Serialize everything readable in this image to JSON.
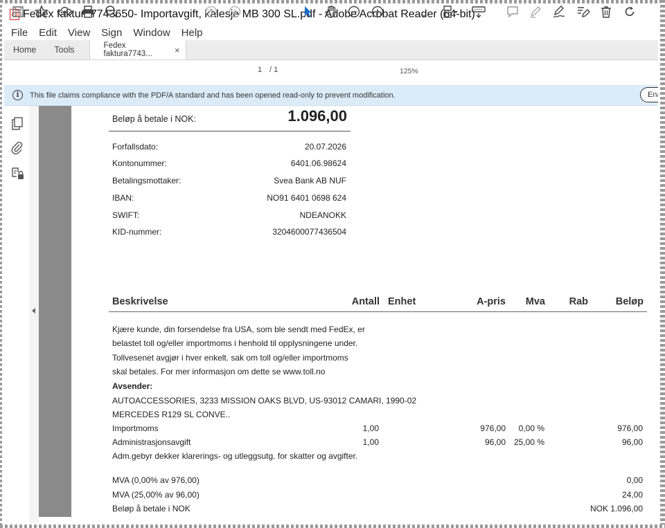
{
  "window": {
    "title": "Fedex faktura7743650- Importavgift, kalesje MB 300 SL.pdf - Adobe Acrobat Reader (64-bit)"
  },
  "menu": [
    "File",
    "Edit",
    "View",
    "Sign",
    "Window",
    "Help"
  ],
  "tabs": {
    "home": "Home",
    "tools": "Tools",
    "document": "Fedex faktura7743...",
    "close": "×"
  },
  "toolbar": {
    "page_current": "1",
    "page_total": "/ 1",
    "zoom": "125%"
  },
  "infobar": {
    "message": "This file claims compliance with the PDF/A standard and has been opened read-only to prevent modification.",
    "button": "Ena"
  },
  "payment": {
    "amount_label": "Beløp å betale i  NOK:",
    "amount_value": "1.096,00",
    "rows": [
      {
        "label": "Forfallsdato:",
        "value": "20.07.2026"
      },
      {
        "label": "Kontonummer:",
        "value": "6401.06.98624"
      },
      {
        "label": "Betalingsmottaker:",
        "value": "Svea Bank AB NUF"
      },
      {
        "label": "IBAN:",
        "value": "NO91 6401 0698 624"
      },
      {
        "label": "SWIFT:",
        "value": "NDEANOKK"
      },
      {
        "label": "KID-nummer:",
        "value": "3204600077436504"
      }
    ]
  },
  "table": {
    "headers": {
      "description": "Beskrivelse",
      "quantity": "Antall",
      "unit": "Enhet",
      "unit_price": "A-pris",
      "vat": "Mva",
      "discount": "Rab",
      "amount": "Beløp"
    },
    "intro": [
      "Kjære kunde, din forsendelse fra USA, som ble sendt med FedEx, er",
      "belastet toll og/eller importmoms i henhold til opplysningene under.",
      "Tollvesenet avgjør i hver enkelt. sak om toll og/eller importmoms",
      "skal betales. For mer informasjon om dette se www.toll.no"
    ],
    "sender_label": "Avsender:",
    "sender_lines": [
      "AUTOACCESSORIES, 3233 MISSION OAKS BLVD, US-93012 CAMARI, 1990-02",
      "MERCEDES R129 SL CONVE.."
    ],
    "items": [
      {
        "description": "Importmoms",
        "quantity": "1,00",
        "unit_price": "976,00",
        "vat": "0,00 %",
        "amount": "976,00"
      },
      {
        "description": "Administrasjonsavgift",
        "quantity": "1,00",
        "unit_price": "96,00",
        "vat": "25,00 %",
        "amount": "96,00"
      }
    ],
    "note": "Adm.gebyr dekker klarerings- og utleggsutg. for skatter og avgifter.",
    "totals": [
      {
        "label": "MVA (0,00% av 976,00)",
        "value": "0,00"
      },
      {
        "label": "MVA (25,00% av 96,00)",
        "value": "24,00"
      },
      {
        "label": "Beløp å betale i NOK",
        "value": "NOK 1.096,00"
      }
    ]
  }
}
